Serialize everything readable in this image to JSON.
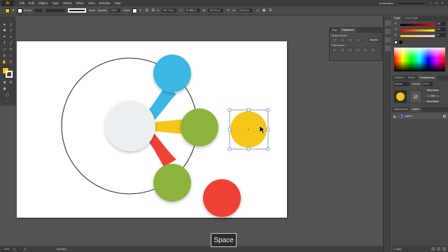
{
  "menubar": {
    "app_logo": "Ai",
    "items": [
      "File",
      "Edit",
      "Object",
      "Type",
      "Select",
      "Effect",
      "View",
      "Window",
      "Help"
    ],
    "workspace": "Automation"
  },
  "control_bar": {
    "selection_label": "",
    "stroke_label": "Stroke:",
    "stroke_profile": "Basic",
    "opacity_label": "Opacity:",
    "opacity_value": "100%",
    "style_label": "Style:",
    "x_label": "X:",
    "x_value": "357.76 px",
    "y_label": "Y:",
    "y_value": "91.888 px",
    "w_label": "W:",
    "w_value": "103.09 px",
    "h_label": "H:",
    "h_value": "103.09 px",
    "fill_color": "#f5c518"
  },
  "toolbox": {
    "tab_label": "",
    "fill_color": "#f5c518",
    "stroke_color": "#ffffff"
  },
  "pathfinder_panel": {
    "tabs": [
      "Align",
      "Pathfinder"
    ],
    "active_tab": "Pathfinder",
    "shape_modes_label": "Shape Modes:",
    "pathfinders_label": "Pathfinders:",
    "expand_label": "Expand"
  },
  "color_panel": {
    "tabs": [
      "Color",
      "Color Guide"
    ],
    "sliders": [
      {
        "label": "R",
        "value": "255",
        "colors": [
          "#000000",
          "#ff0000"
        ]
      },
      {
        "label": "G",
        "value": "197",
        "colors": [
          "#000000",
          "#ffff00"
        ]
      },
      {
        "label": "B",
        "value": "24",
        "colors": [
          "#000000",
          "#0000ff"
        ]
      }
    ]
  },
  "transparency_panel": {
    "tabs": [
      "Gradient",
      "Stroke",
      "Transparency"
    ],
    "active_tab": "Transparency",
    "blend_mode": "Normal",
    "opacity_label": "Opacity:",
    "opacity_value": "100%",
    "make_mask_label": "Make Mask",
    "clip_label": "Clip",
    "invert_label": "Invert Mask"
  },
  "layers_panel": {
    "tabs": [
      "Appearance",
      "Layers"
    ],
    "active_tab": "Layers",
    "layer_name": "Layer 1",
    "footer_text": "1 Layer"
  },
  "statusbar": {
    "zoom": "100%",
    "artboard_num": "1",
    "tool_status": "Selection"
  },
  "overlay": {
    "key_label": "Space"
  },
  "colors": {
    "blue": "#3cb6e3",
    "green": "#8db33c",
    "yellow": "#f5c518",
    "red": "#ef4136",
    "hub": "#eceff1"
  }
}
